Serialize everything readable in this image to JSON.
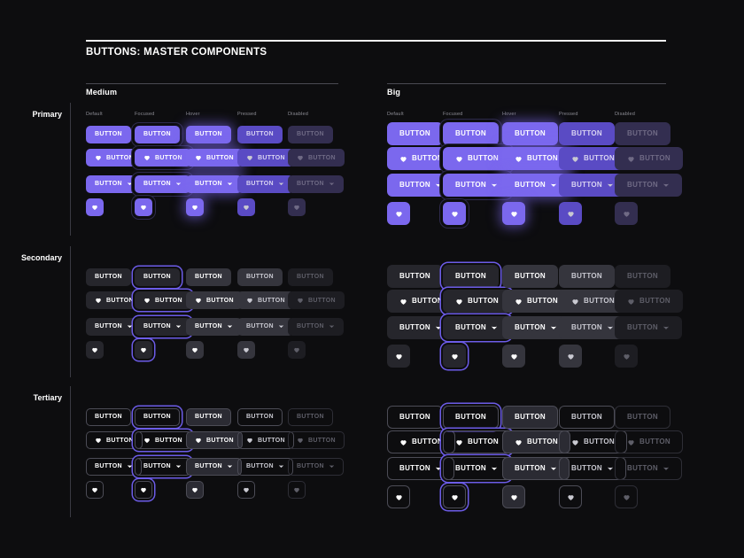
{
  "page": {
    "title": "BUTTONS: MASTER COMPONENTS",
    "background": "#0d0d0f"
  },
  "sizes": [
    {
      "key": "medium",
      "label": "Medium"
    },
    {
      "key": "big",
      "label": "Big"
    }
  ],
  "states": [
    {
      "key": "default",
      "label": "Default"
    },
    {
      "key": "focused",
      "label": "Focused"
    },
    {
      "key": "hover",
      "label": "Hover"
    },
    {
      "key": "pressed",
      "label": "Pressed"
    },
    {
      "key": "disabled",
      "label": "Disabled"
    }
  ],
  "variants": [
    {
      "key": "primary",
      "label": "Primary"
    },
    {
      "key": "secondary",
      "label": "Secondary"
    },
    {
      "key": "tertiary",
      "label": "Tertiary"
    }
  ],
  "shapes": [
    {
      "key": "text",
      "label": "BUTTON",
      "icon": null,
      "trailing": null
    },
    {
      "key": "icon-text",
      "label": "BUTTON",
      "icon": "heart-icon",
      "trailing": null
    },
    {
      "key": "text-chevron",
      "label": "BUTTON",
      "icon": null,
      "trailing": "chevron-down-icon"
    },
    {
      "key": "icon-only",
      "label": "",
      "icon": "heart-icon",
      "trailing": null
    }
  ],
  "button_label": "BUTTON",
  "colors": {
    "primary": "#7b68ee",
    "primary_pressed": "#5a4bc4",
    "primary_disabled": "#332e50",
    "secondary": "#26262c",
    "secondary_hover": "#35353d",
    "secondary_disabled": "#1d1d22",
    "tertiary_border": "#4c4c56",
    "focus_ring": "#6c5ce7",
    "text_primary": "#ffffff",
    "text_muted": "#8e8e96",
    "text_disabled": "#5e5e68",
    "divider": "#3a3a42",
    "rule": "#f2f2f4"
  }
}
